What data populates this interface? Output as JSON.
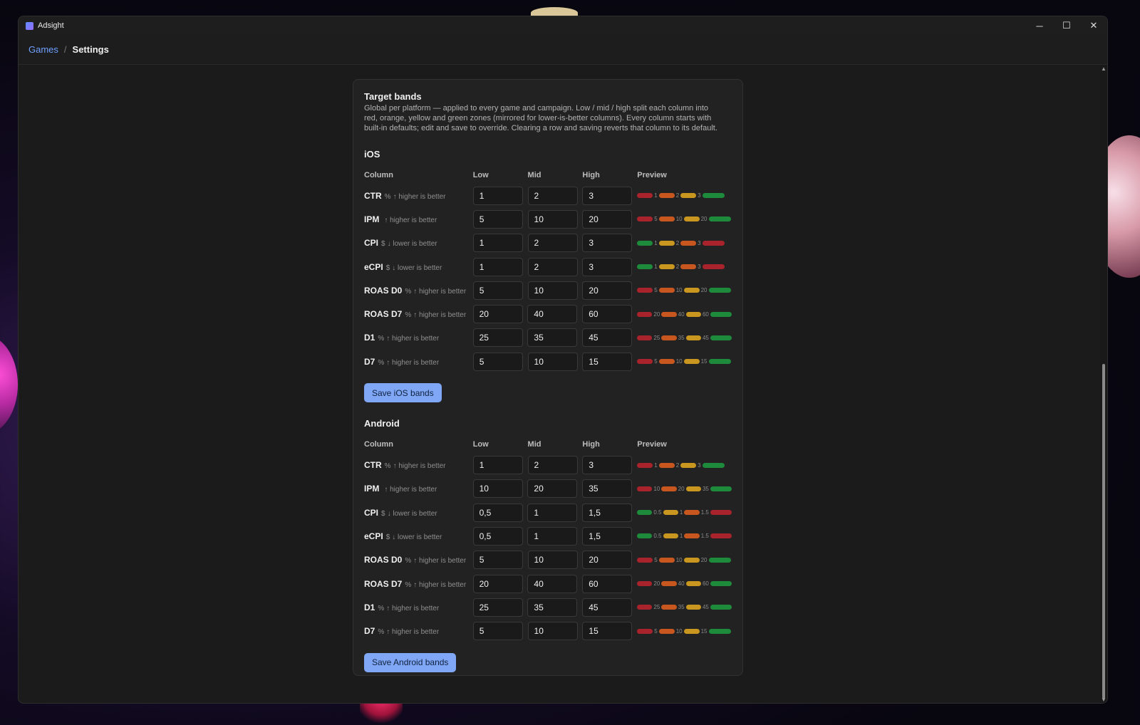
{
  "window": {
    "title": "Adsight",
    "minimize": "─",
    "maximize": "☐",
    "close": "✕"
  },
  "breadcrumb": {
    "link": "Games",
    "separator": "/",
    "current": "Settings"
  },
  "card": {
    "title": "Target bands",
    "description": "Global per platform — applied to every game and campaign. Low / mid / high split each column into red, orange, yellow and green zones (mirrored for lower-is-better columns). Every column starts with built-in defaults; edit and save to override. Clearing a row and saving reverts that column to its default."
  },
  "colors": {
    "red": "#a8232b",
    "orange": "#c8561f",
    "yellow": "#c9961f",
    "green": "#1e8a3c",
    "accent": "#7fa7f5"
  },
  "headers": {
    "column": "Column",
    "low": "Low",
    "mid": "Mid",
    "high": "High",
    "preview": "Preview"
  },
  "ios": {
    "title": "iOS",
    "save_label": "Save iOS bands",
    "rows": [
      {
        "name": "CTR",
        "unit": "%",
        "dir": "↑ higher is better",
        "low": "1",
        "mid": "2",
        "high": "3",
        "t1": "1",
        "t2": "2",
        "t3": "3",
        "p": [
          "red",
          "orange",
          "yellow",
          "green"
        ]
      },
      {
        "name": "IPM",
        "unit": "",
        "dir": "↑ higher is better",
        "low": "5",
        "mid": "10",
        "high": "20",
        "t1": "5",
        "t2": "10",
        "t3": "20",
        "p": [
          "red",
          "orange",
          "yellow",
          "green"
        ]
      },
      {
        "name": "CPI",
        "unit": "$",
        "dir": "↓ lower is better",
        "low": "1",
        "mid": "2",
        "high": "3",
        "t1": "1",
        "t2": "2",
        "t3": "3",
        "p": [
          "green",
          "yellow",
          "orange",
          "red"
        ]
      },
      {
        "name": "eCPI",
        "unit": "$",
        "dir": "↓ lower is better",
        "low": "1",
        "mid": "2",
        "high": "3",
        "t1": "1",
        "t2": "2",
        "t3": "3",
        "p": [
          "green",
          "yellow",
          "orange",
          "red"
        ]
      },
      {
        "name": "ROAS D0",
        "unit": "%",
        "dir": "↑ higher is better",
        "low": "5",
        "mid": "10",
        "high": "20",
        "t1": "5",
        "t2": "10",
        "t3": "20",
        "p": [
          "red",
          "orange",
          "yellow",
          "green"
        ]
      },
      {
        "name": "ROAS D7",
        "unit": "%",
        "dir": "↑ higher is better",
        "low": "20",
        "mid": "40",
        "high": "60",
        "t1": "20",
        "t2": "40",
        "t3": "60",
        "p": [
          "red",
          "orange",
          "yellow",
          "green"
        ]
      },
      {
        "name": "D1",
        "unit": "%",
        "dir": "↑ higher is better",
        "low": "25",
        "mid": "35",
        "high": "45",
        "t1": "25",
        "t2": "35",
        "t3": "45",
        "p": [
          "red",
          "orange",
          "yellow",
          "green"
        ]
      },
      {
        "name": "D7",
        "unit": "%",
        "dir": "↑ higher is better",
        "low": "5",
        "mid": "10",
        "high": "15",
        "t1": "5",
        "t2": "10",
        "t3": "15",
        "p": [
          "red",
          "orange",
          "yellow",
          "green"
        ]
      }
    ]
  },
  "android": {
    "title": "Android",
    "save_label": "Save Android bands",
    "rows": [
      {
        "name": "CTR",
        "unit": "%",
        "dir": "↑ higher is better",
        "low": "1",
        "mid": "2",
        "high": "3",
        "t1": "1",
        "t2": "2",
        "t3": "3",
        "p": [
          "red",
          "orange",
          "yellow",
          "green"
        ]
      },
      {
        "name": "IPM",
        "unit": "",
        "dir": "↑ higher is better",
        "low": "10",
        "mid": "20",
        "high": "35",
        "t1": "10",
        "t2": "20",
        "t3": "35",
        "p": [
          "red",
          "orange",
          "yellow",
          "green"
        ]
      },
      {
        "name": "CPI",
        "unit": "$",
        "dir": "↓ lower is better",
        "low": "0,5",
        "mid": "1",
        "high": "1,5",
        "t1": "0.5",
        "t2": "1",
        "t3": "1.5",
        "p": [
          "green",
          "yellow",
          "orange",
          "red"
        ]
      },
      {
        "name": "eCPI",
        "unit": "$",
        "dir": "↓ lower is better",
        "low": "0,5",
        "mid": "1",
        "high": "1,5",
        "t1": "0.5",
        "t2": "1",
        "t3": "1.5",
        "p": [
          "green",
          "yellow",
          "orange",
          "red"
        ]
      },
      {
        "name": "ROAS D0",
        "unit": "%",
        "dir": "↑ higher is better",
        "low": "5",
        "mid": "10",
        "high": "20",
        "t1": "5",
        "t2": "10",
        "t3": "20",
        "p": [
          "red",
          "orange",
          "yellow",
          "green"
        ]
      },
      {
        "name": "ROAS D7",
        "unit": "%",
        "dir": "↑ higher is better",
        "low": "20",
        "mid": "40",
        "high": "60",
        "t1": "20",
        "t2": "40",
        "t3": "60",
        "p": [
          "red",
          "orange",
          "yellow",
          "green"
        ]
      },
      {
        "name": "D1",
        "unit": "%",
        "dir": "↑ higher is better",
        "low": "25",
        "mid": "35",
        "high": "45",
        "t1": "25",
        "t2": "35",
        "t3": "45",
        "p": [
          "red",
          "orange",
          "yellow",
          "green"
        ]
      },
      {
        "name": "D7",
        "unit": "%",
        "dir": "↑ higher is better",
        "low": "5",
        "mid": "10",
        "high": "15",
        "t1": "5",
        "t2": "10",
        "t3": "15",
        "p": [
          "red",
          "orange",
          "yellow",
          "green"
        ]
      }
    ]
  }
}
